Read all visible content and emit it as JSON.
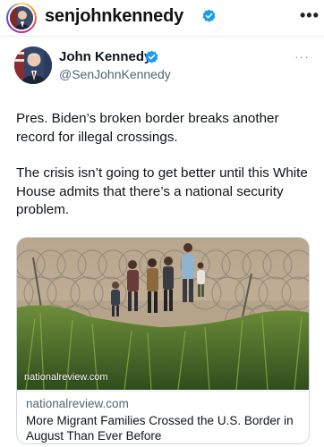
{
  "instagram": {
    "username": "senjohnkennedy",
    "more_icon": "more-horizontal-icon",
    "verified_icon": "verified-badge-icon"
  },
  "tweet": {
    "author_name": "John Kennedy",
    "handle": "@SenJohnKennedy",
    "verified_icon": "verified-badge-icon",
    "more_icon": "more-horizontal-icon",
    "paragraphs": [
      "Pres. Biden’s broken border breaks another record for illegal crossings.",
      "The crisis isn’t going to get better until this White House admits that there’s a national security problem."
    ],
    "link_card": {
      "image_overlay_domain": "nationalreview.com",
      "site": "nationalreview.com",
      "title": "More Migrant Families Crossed the U.S. Border in August Than Ever Before"
    }
  },
  "colors": {
    "verified_blue": "#1d9bf0",
    "text_primary": "#0f1419",
    "text_secondary": "#536471",
    "card_border": "#cfd9de"
  }
}
